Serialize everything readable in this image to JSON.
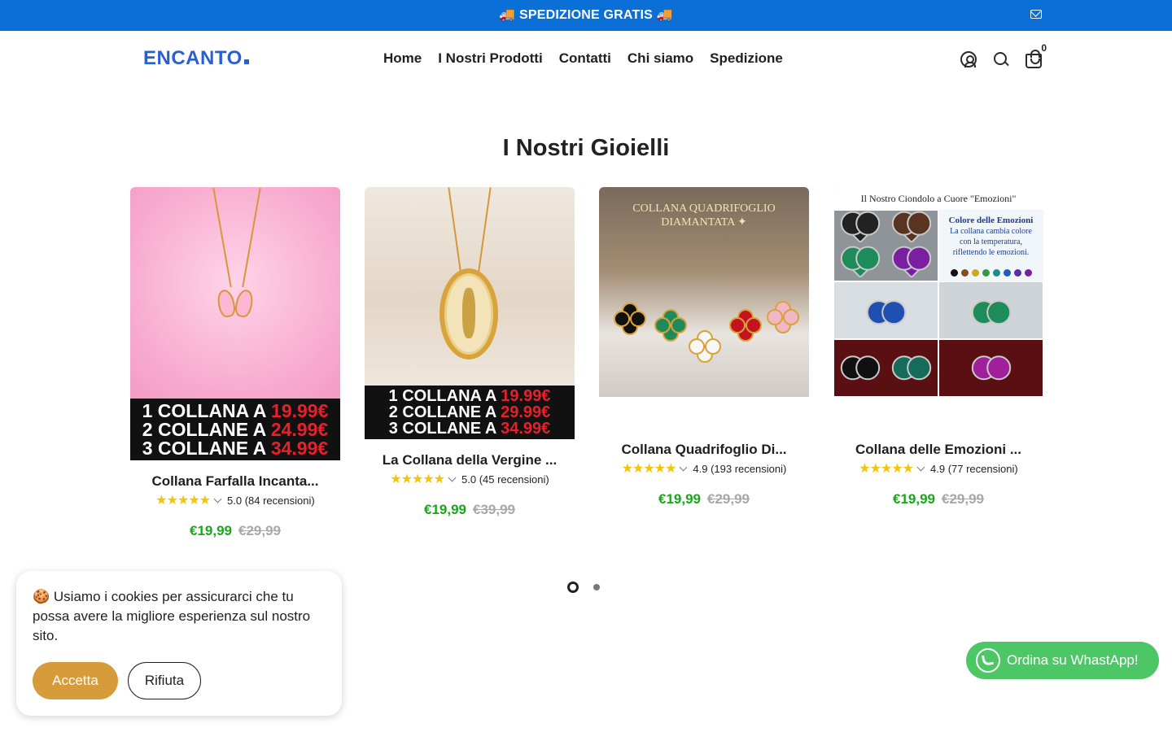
{
  "topbar": {
    "message": "🚚 SPEDIZIONE GRATIS 🚚",
    "icon": "mail-icon",
    "bg_color": "#0a6fd6"
  },
  "header": {
    "logo": "ENCANTO",
    "nav": [
      "Home",
      "I Nostri Prodotti",
      "Contatti",
      "Chi siamo",
      "Spedizione"
    ],
    "cart_count": "0"
  },
  "section": {
    "title": "I Nostri Gioielli"
  },
  "products": [
    {
      "name": "Collana Farfalla Incanta...",
      "stars": "★★★★★",
      "rating": "5.0 (84 recensioni)",
      "price": "€19,99",
      "old_price": "€29,99",
      "promo": [
        "1 COLLANA A ",
        "19.99€",
        "2 COLLANE A ",
        "24.99€",
        "3 COLLANE A ",
        "34.99€"
      ]
    },
    {
      "name": "La Collana della Vergine ...",
      "stars": "★★★★★",
      "rating": "5.0 (45 recensioni)",
      "price": "€19,99",
      "old_price": "€39,99",
      "promo": [
        "1 COLLANA A ",
        "19.99€",
        "2 COLLANE A ",
        "29.99€",
        "3 COLLANE A ",
        "34.99€"
      ]
    },
    {
      "name": "Collana Quadrifoglio Di...",
      "stars": "★★★★★",
      "rating": "4.9 (193 recensioni)",
      "price": "€19,99",
      "old_price": "€29,99",
      "image_caption": [
        "COLLANA QUADRIFOGLIO",
        "DIAMANTATA ✦"
      ]
    },
    {
      "name": "Collana delle Emozioni ...",
      "stars": "★★★★★",
      "rating": "4.9 (77 recensioni)",
      "price": "€19,99",
      "old_price": "€29,99",
      "image_title": "Il Nostro Ciondolo a Cuore \"Emozioni\"",
      "panel_title": "Colore delle Emozioni",
      "panel_text": "La collana cambia colore con la temperatura, riflettendo le emozioni."
    }
  ],
  "pager": {
    "active_index": 0,
    "count": 2
  },
  "cookie": {
    "emoji": "🍪",
    "text_before": " Usiamo i ",
    "link": "cookies",
    "text_after": " per assicurarci che tu possa avere la migliore esperienza sul nostro sito.",
    "accept": "Accetta",
    "reject": "Rifiuta",
    "accept_color": "#d69c3c"
  },
  "whatsapp": {
    "label": "Ordina su WhastApp!",
    "icon": "whatsapp-icon",
    "color": "#4dc766"
  }
}
